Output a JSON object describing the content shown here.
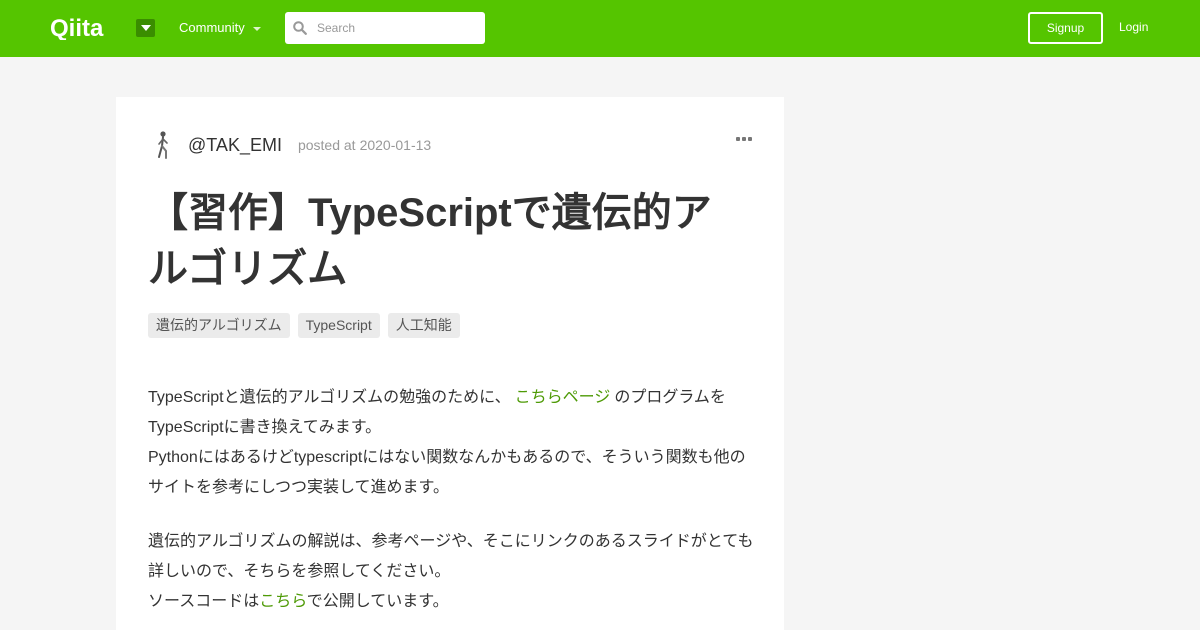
{
  "header": {
    "logo_text": "Qiita",
    "community_label": "Community",
    "search_placeholder": "Search",
    "signup_label": "Signup",
    "login_label": "Login",
    "brand_color": "#55c500"
  },
  "article": {
    "username": "@TAK_EMI",
    "posted_prefix": "posted at",
    "posted_date": "2020-01-13",
    "title": "【習作】TypeScriptで遺伝的アルゴリズム",
    "tags": [
      "遺伝的アルゴリズム",
      "TypeScript",
      "人工知能"
    ],
    "paragraph1": {
      "part1": "TypeScriptと遺伝的アルゴリズムの勉強のために、",
      "link": "こちらページ",
      "part2": "のプログラムをTypeScriptに書き換えてみます。",
      "line2": "Pythonにはあるけどtypescriptにはない関数なんかもあるので、そういう関数も他のサイトを参考にしつつ実装して進めます。"
    },
    "paragraph2": {
      "line1": "遺伝的アルゴリズムの解説は、参考ページや、そこにリンクのあるスライドがとても詳しいので、そちらを参照してください。",
      "part1": "ソースコードは",
      "link": "こちら",
      "part2": "で公開しています。"
    },
    "link_color": "#4e9a06"
  }
}
